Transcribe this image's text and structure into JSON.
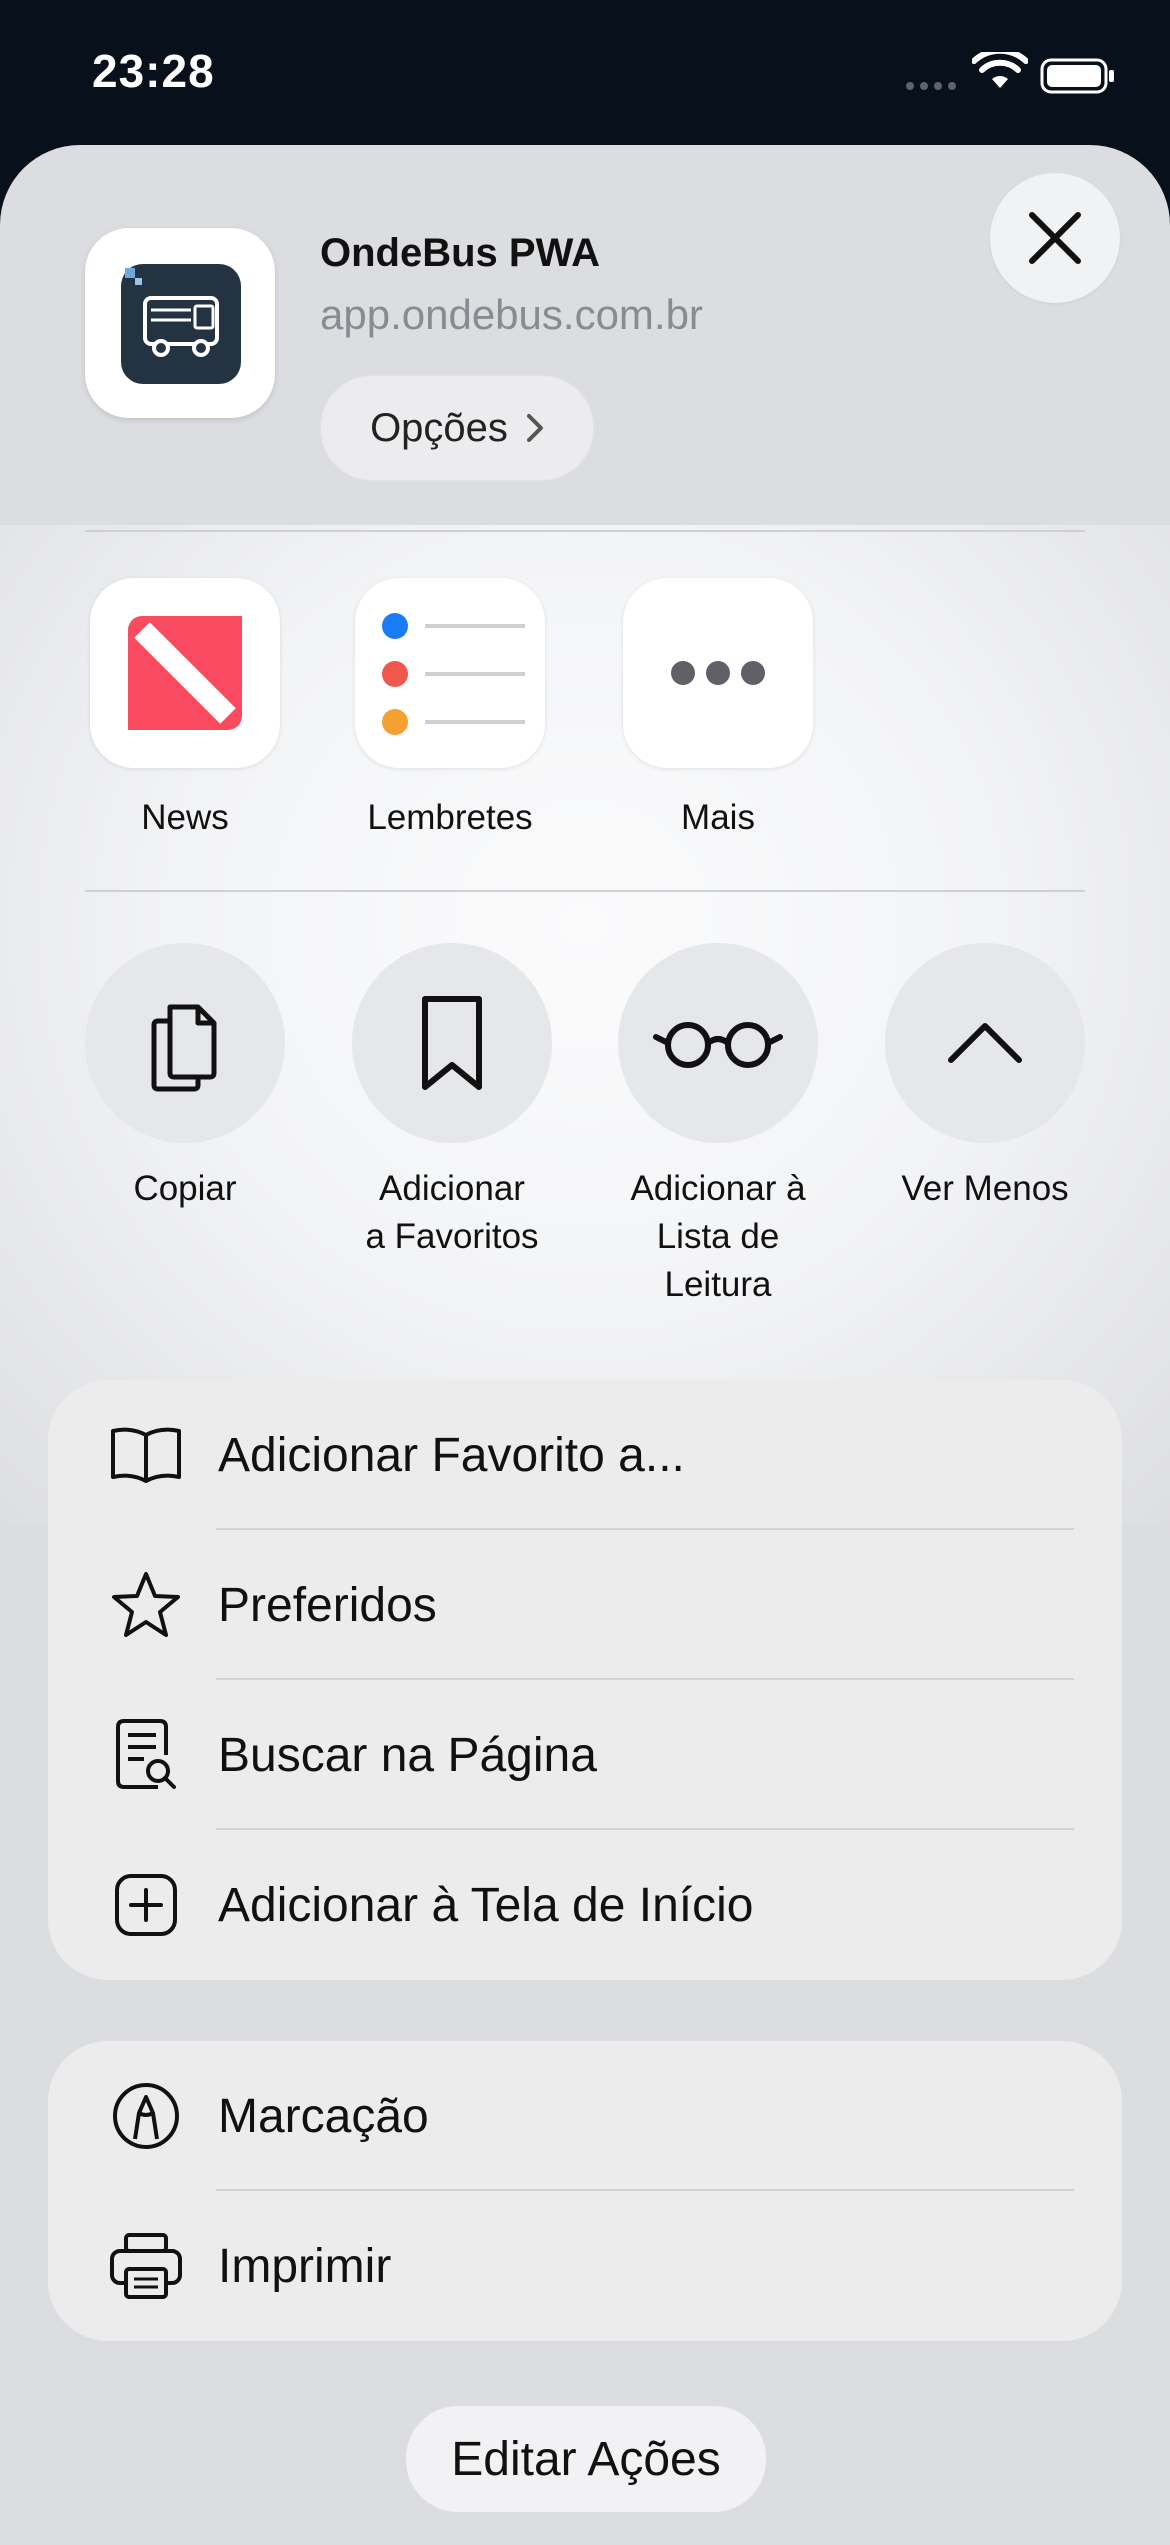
{
  "status_bar": {
    "time": "23:28"
  },
  "app": {
    "name": "OndeBus PWA",
    "url": "app.ondebus.com.br",
    "options_label": "Opções"
  },
  "apps": [
    {
      "label": "News",
      "icon": "news-app-icon"
    },
    {
      "label": "Lembretes",
      "icon": "reminders-app-icon"
    },
    {
      "label": "Mais",
      "icon": "more-icon"
    }
  ],
  "actions": [
    {
      "label": "Copiar",
      "icon": "copy-icon"
    },
    {
      "label": "Adicionar\na Favoritos",
      "icon": "bookmark-icon"
    },
    {
      "label": "Adicionar à\nLista de\nLeitura",
      "icon": "glasses-icon"
    },
    {
      "label": "Ver Menos",
      "icon": "chevron-up-icon"
    }
  ],
  "menu_primary": [
    {
      "label": "Adicionar Favorito a...",
      "icon": "book-icon"
    },
    {
      "label": "Preferidos",
      "icon": "star-icon"
    },
    {
      "label": "Buscar na Página",
      "icon": "find-in-page-icon"
    },
    {
      "label": "Adicionar à Tela de Início",
      "icon": "add-square-icon"
    }
  ],
  "menu_secondary": [
    {
      "label": "Marcação",
      "icon": "markup-icon"
    },
    {
      "label": "Imprimir",
      "icon": "printer-icon"
    }
  ],
  "edit_actions_label": "Editar Ações",
  "colors": {
    "news_red": "#fa4a5f",
    "reminder_blue": "#1a7cf5",
    "reminder_red": "#f0584e",
    "reminder_orange": "#f4a033",
    "app_icon_bg": "#233342"
  }
}
